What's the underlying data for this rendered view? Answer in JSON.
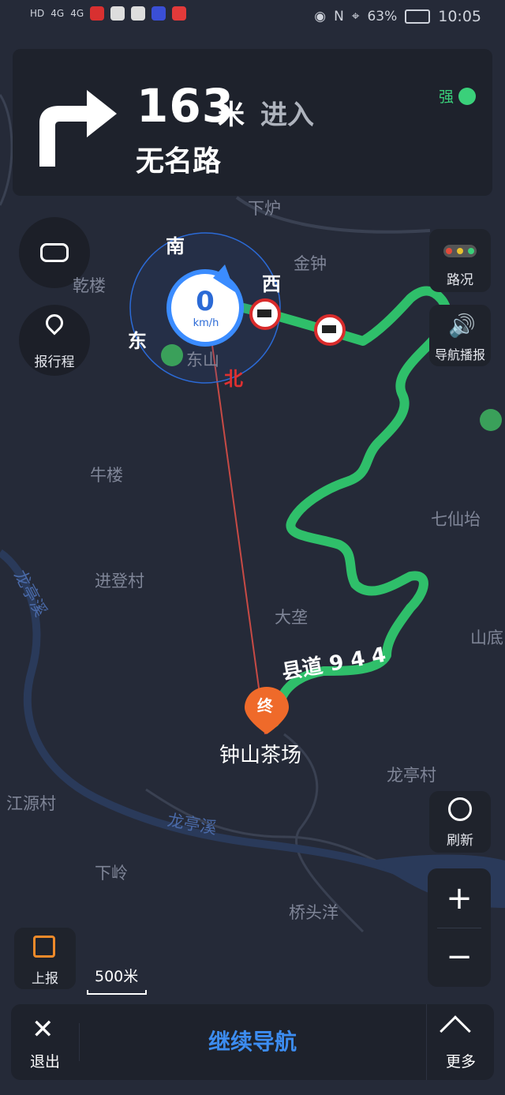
{
  "status_bar": {
    "left_items": [
      "HD",
      "4G",
      "4G"
    ],
    "battery": "63%",
    "time": "10:05"
  },
  "navigation": {
    "distance": "163",
    "distance_unit": "米",
    "action": "进入",
    "road_name": "无名路",
    "signal": "强",
    "turn_direction": "right-turn-arrow"
  },
  "compass": {
    "speed": "0",
    "speed_unit": "km/h",
    "north": "北",
    "south": "南",
    "east": "东",
    "west": "西"
  },
  "left_buttons": {
    "report_trip": "报行程"
  },
  "right_buttons": {
    "traffic": "路况",
    "voice": "导航播报",
    "refresh": "刷新"
  },
  "map_labels": {
    "xialu": "下炉",
    "jinzhong": "金钟",
    "donglou": "乾楼",
    "dongshan": "东山",
    "niulou": "牛楼",
    "qixiantai": "七仙坮",
    "jindengcun": "进登村",
    "longtingxi_top": "龙亭溪",
    "dakeng": "大垄",
    "shandi": "山底",
    "road_label": "县道 9 4 4",
    "destination_marker": "终",
    "destination": "钟山茶场",
    "longtingcun": "龙亭村",
    "jiangyuancun": "江源村",
    "longtingxi": "龙亭溪",
    "xialing": "下岭",
    "qiaotouyang": "桥头洋"
  },
  "controls": {
    "zoom_in": "+",
    "zoom_out": "−",
    "report": "上报",
    "scale": "500米"
  },
  "bottom": {
    "exit": "退出",
    "continue": "继续导航",
    "more": "更多"
  },
  "colors": {
    "route": "#2fbf6a",
    "accent": "#3c8cf0",
    "map_bg": "#252a38"
  }
}
